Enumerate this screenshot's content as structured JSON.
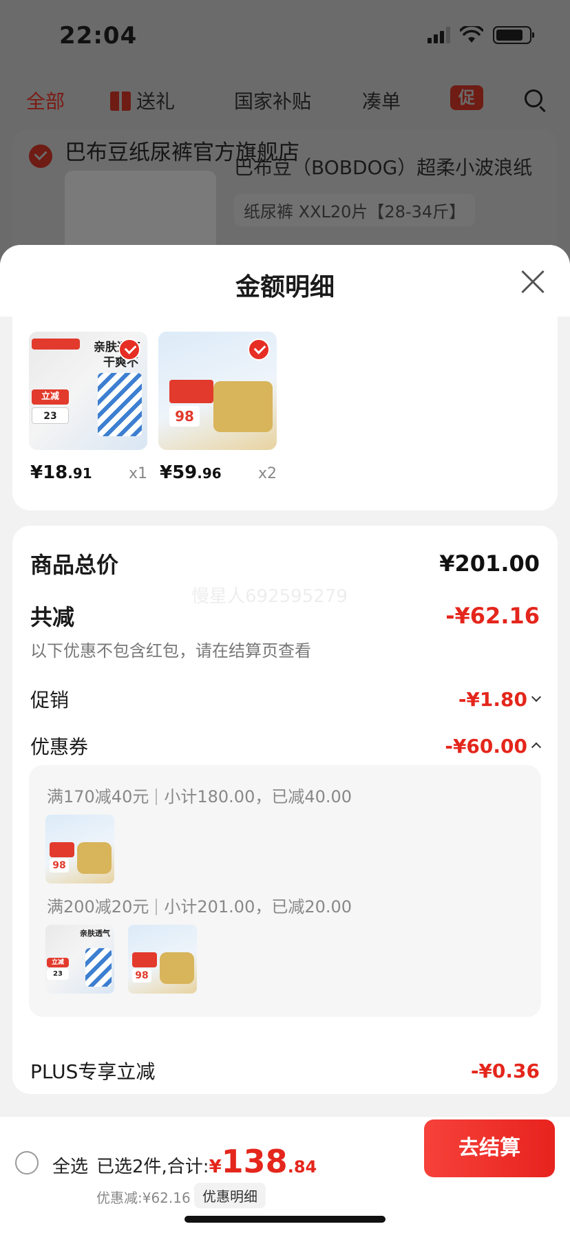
{
  "status_bar": {
    "time": "22:04"
  },
  "background": {
    "tabs": [
      "全部",
      "送礼",
      "国家补贴",
      "凑单"
    ],
    "promo_badge": "促",
    "store_name": "巴布豆纸尿裤官方旗舰店",
    "product_title": "巴布豆（BOBDOG）超柔小波浪纸",
    "product_spec": "纸尿裤 XXL20片【28-34斤】"
  },
  "sheet": {
    "title": "金额明细",
    "products": [
      {
        "price_int": "¥18",
        "price_dec": ".91",
        "qty": "x1",
        "img_text_1": "亲肤透气",
        "img_text_2": "干爽不闷",
        "img_badge_1": "立减",
        "img_badge_2": "23"
      },
      {
        "price_int": "¥59",
        "price_dec": ".96",
        "qty": "x2",
        "img_badge_1": "98"
      }
    ],
    "summary": {
      "total_label": "商品总价",
      "total_value": "¥201.00",
      "reduce_label": "共减",
      "reduce_value": "-¥62.16",
      "note": "以下优惠不包含红包，请在结算页查看",
      "promo_label": "促销",
      "promo_value": "-¥1.80",
      "coupon_label": "优惠券",
      "coupon_value": "-¥60.00",
      "watermark": "慢星人692595279"
    },
    "coupons": [
      {
        "rule": "满170减40元",
        "detail": "小计180.00，已减40.00"
      },
      {
        "rule": "满200减20元",
        "detail": "小计201.00，已减20.00"
      }
    ],
    "plus": {
      "label": "PLUS专享立减",
      "value": "-¥0.36"
    }
  },
  "footer": {
    "select_all": "全选",
    "picked_label": "已选2件,合计:",
    "total_currency": "¥",
    "total_int": "138",
    "total_dec": ".84",
    "saved": "优惠减:¥62.16",
    "detail_link": "优惠明细",
    "checkout": "去结算"
  },
  "colors": {
    "accent": "#e4261c",
    "checkout": "#f0302a"
  }
}
